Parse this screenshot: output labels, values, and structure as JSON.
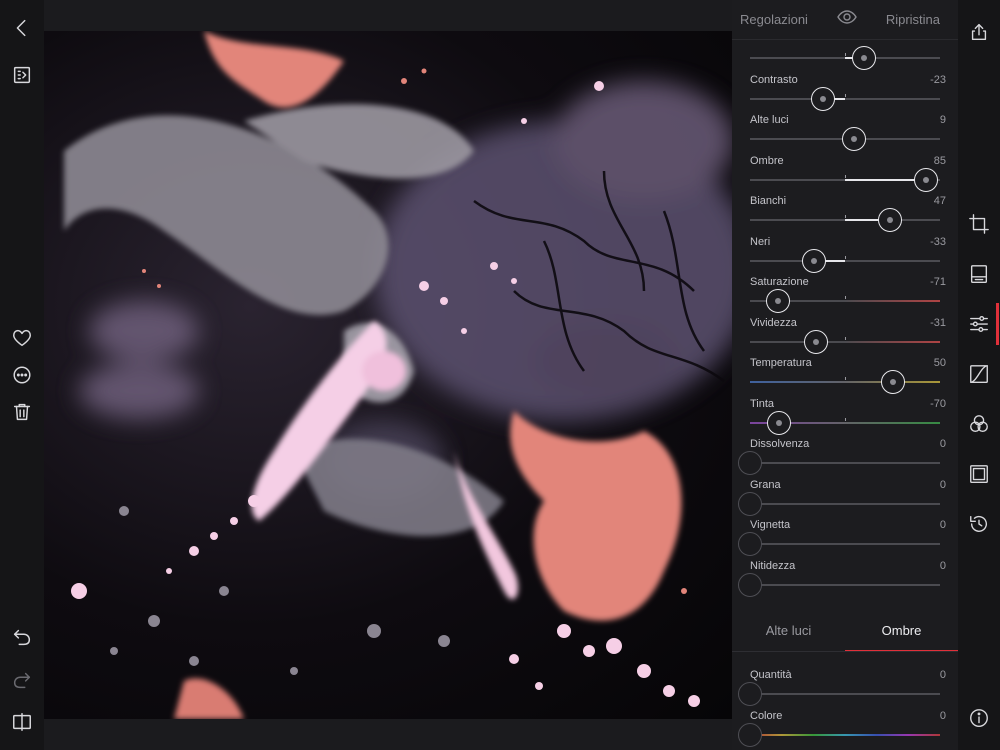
{
  "panel": {
    "title": "Regolazioni",
    "reset_label": "Ripristina"
  },
  "sliders": [
    {
      "label": "",
      "value": "",
      "numeric": 20,
      "kind": "mono"
    },
    {
      "label": "Contrasto",
      "value": "-23",
      "numeric": -23,
      "kind": "mono"
    },
    {
      "label": "Alte luci",
      "value": "9",
      "numeric": 9,
      "kind": "mono"
    },
    {
      "label": "Ombre",
      "value": "85",
      "numeric": 85,
      "kind": "mono"
    },
    {
      "label": "Bianchi",
      "value": "47",
      "numeric": 47,
      "kind": "mono"
    },
    {
      "label": "Neri",
      "value": "-33",
      "numeric": -33,
      "kind": "mono"
    },
    {
      "label": "Saturazione",
      "value": "-71",
      "numeric": -71,
      "kind": "saturation"
    },
    {
      "label": "Vividezza",
      "value": "-31",
      "numeric": -31,
      "kind": "saturation"
    },
    {
      "label": "Temperatura",
      "value": "50",
      "numeric": 50,
      "kind": "temperature"
    },
    {
      "label": "Tinta",
      "value": "-70",
      "numeric": -70,
      "kind": "tint"
    },
    {
      "label": "Dissolvenza",
      "value": "0",
      "numeric": 0,
      "kind": "zero"
    },
    {
      "label": "Grana",
      "value": "0",
      "numeric": 0,
      "kind": "zero"
    },
    {
      "label": "Vignetta",
      "value": "0",
      "numeric": 0,
      "kind": "zero"
    },
    {
      "label": "Nitidezza",
      "value": "0",
      "numeric": 0,
      "kind": "zero"
    }
  ],
  "split_tabs": [
    {
      "label": "Alte luci",
      "active": false
    },
    {
      "label": "Ombre",
      "active": true
    }
  ],
  "split_sliders": [
    {
      "label": "Quantità",
      "value": "0",
      "numeric": 0,
      "kind": "zero"
    },
    {
      "label": "Colore",
      "value": "0",
      "numeric": 0,
      "kind": "hue"
    }
  ],
  "colors": {
    "accent": "#e0303a",
    "panel_bg": "#1c1c1f",
    "toolbar_bg": "#151517"
  }
}
